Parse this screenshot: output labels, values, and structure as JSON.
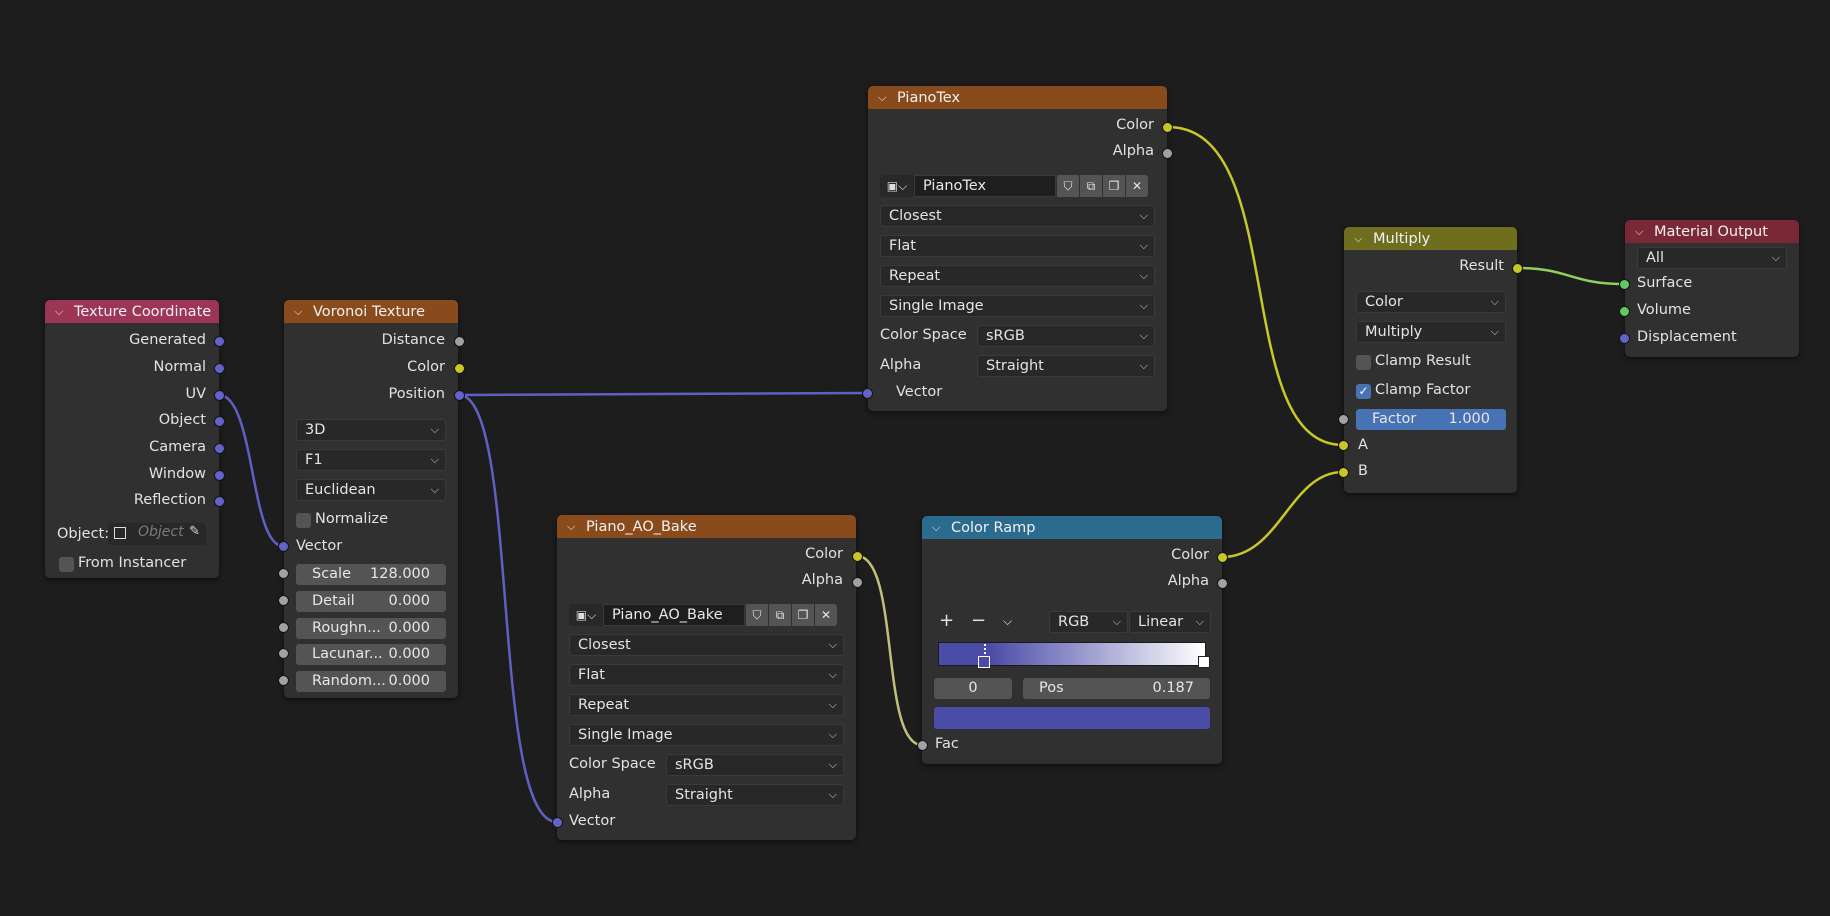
{
  "nodes": {
    "texture_coordinate": {
      "title": "Texture Coordinate",
      "header_color": "#9c3556",
      "outputs": [
        "Generated",
        "Normal",
        "UV",
        "Object",
        "Camera",
        "Window",
        "Reflection"
      ],
      "object_label": "Object:",
      "object_placeholder": "Object",
      "from_instancer_label": "From Instancer"
    },
    "voronoi": {
      "title": "Voronoi Texture",
      "header_color": "#8a4b1c",
      "outputs": [
        "Distance",
        "Color",
        "Position"
      ],
      "dimensions": "3D",
      "feature": "F1",
      "metric": "Euclidean",
      "normalize_label": "Normalize",
      "vector_label": "Vector",
      "fields": [
        {
          "label": "Scale",
          "value": "128.000"
        },
        {
          "label": "Detail",
          "value": "0.000"
        },
        {
          "label": "Roughn...",
          "value": "0.000"
        },
        {
          "label": "Lacunar...",
          "value": "0.000"
        },
        {
          "label": "Random...",
          "value": "0.000"
        }
      ]
    },
    "pianotex": {
      "title": "PianoTex",
      "header_color": "#8a4b1c",
      "outputs": [
        "Color",
        "Alpha"
      ],
      "image_name": "PianoTex",
      "interpolation": "Closest",
      "projection": "Flat",
      "extension": "Repeat",
      "source": "Single Image",
      "color_space_label": "Color Space",
      "color_space": "sRGB",
      "alpha_label": "Alpha",
      "alpha": "Straight",
      "vector_label": "Vector"
    },
    "ao_bake": {
      "title": "Piano_AO_Bake",
      "header_color": "#8a4b1c",
      "outputs": [
        "Color",
        "Alpha"
      ],
      "image_name": "Piano_AO_Bake",
      "interpolation": "Closest",
      "projection": "Flat",
      "extension": "Repeat",
      "source": "Single Image",
      "color_space_label": "Color Space",
      "color_space": "sRGB",
      "alpha_label": "Alpha",
      "alpha": "Straight",
      "vector_label": "Vector"
    },
    "color_ramp": {
      "title": "Color Ramp",
      "header_color": "#2b6b8e",
      "outputs": [
        "Color",
        "Alpha"
      ],
      "add_label": "+",
      "remove_label": "−",
      "color_mode": "RGB",
      "interpolation": "Linear",
      "stop_index": "0",
      "pos_label": "Pos",
      "pos_value": "0.187",
      "stop_color": "#4b4ba8",
      "fac_label": "Fac"
    },
    "multiply": {
      "title": "Multiply",
      "header_color": "#6e6e1e",
      "result_label": "Result",
      "data_type": "Color",
      "blend_mode": "Multiply",
      "clamp_result_label": "Clamp Result",
      "clamp_result_checked": false,
      "clamp_factor_label": "Clamp Factor",
      "clamp_factor_checked": true,
      "factor_label": "Factor",
      "factor_value": "1.000",
      "input_a": "A",
      "input_b": "B"
    },
    "material_output": {
      "title": "Material Output",
      "header_color": "#7a2835",
      "target": "All",
      "inputs": [
        "Surface",
        "Volume",
        "Displacement"
      ]
    }
  },
  "colors": {
    "background": "#1d1d1d",
    "node_body": "#303030",
    "socket_vector": "#6363c7",
    "socket_color": "#c7c729",
    "socket_float": "#a1a1a1",
    "socket_shader": "#63c763",
    "accent": "#4772b3"
  }
}
